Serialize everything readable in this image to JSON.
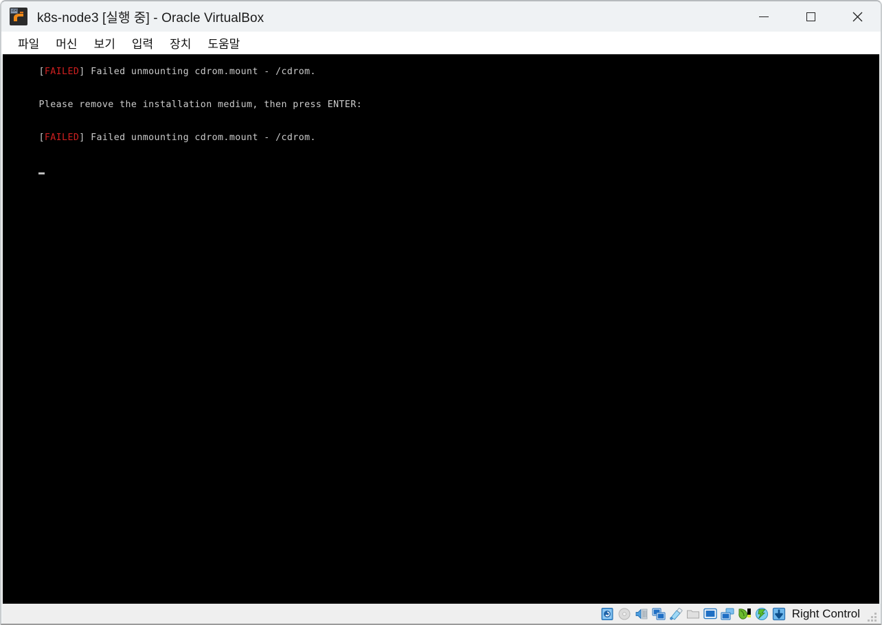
{
  "window": {
    "title": "k8s-node3 [실행 중] - Oracle VirtualBox",
    "app_icon_name": "virtualbox-icon",
    "app_icon_badge": "x64",
    "controls": {
      "minimize": "—",
      "maximize": "□",
      "close": "✕"
    }
  },
  "menubar": {
    "items": [
      {
        "label": "파일",
        "name": "menu-file"
      },
      {
        "label": "머신",
        "name": "menu-machine"
      },
      {
        "label": "보기",
        "name": "menu-view"
      },
      {
        "label": "입력",
        "name": "menu-input"
      },
      {
        "label": "장치",
        "name": "menu-devices"
      },
      {
        "label": "도움말",
        "name": "menu-help"
      }
    ]
  },
  "terminal": {
    "background": "#000000",
    "foreground": "#cccccc",
    "error_color": "#d02020",
    "lines": [
      {
        "prefix_open": "[",
        "status": "FAILED",
        "prefix_close": "] ",
        "text": "Failed unmounting cdrom.mount - /cdrom."
      },
      {
        "prefix_open": "",
        "status": "",
        "prefix_close": "",
        "text": "Please remove the installation medium, then press ENTER:"
      },
      {
        "prefix_open": "[",
        "status": "FAILED",
        "prefix_close": "] ",
        "text": "Failed unmounting cdrom.mount - /cdrom."
      }
    ],
    "cursor_visible": true
  },
  "statusbar": {
    "icons": [
      {
        "name": "hard-disk-icon",
        "title": "하드 디스크"
      },
      {
        "name": "optical-drive-icon",
        "title": "광학 드라이브"
      },
      {
        "name": "audio-icon",
        "title": "오디오"
      },
      {
        "name": "network-icon",
        "title": "네트워크"
      },
      {
        "name": "usb-icon",
        "title": "USB"
      },
      {
        "name": "shared-folders-icon",
        "title": "공유 폴더"
      },
      {
        "name": "display-icon",
        "title": "디스플레이"
      },
      {
        "name": "recording-icon",
        "title": "녹화"
      },
      {
        "name": "mouse-integration-icon",
        "title": "마우스 통합"
      },
      {
        "name": "host-network-icon",
        "title": "호스트 네트워크"
      },
      {
        "name": "host-key-icon",
        "title": "호스트 키"
      }
    ],
    "host_key_label": "Right Control",
    "resize_grip": "resize-grip"
  }
}
